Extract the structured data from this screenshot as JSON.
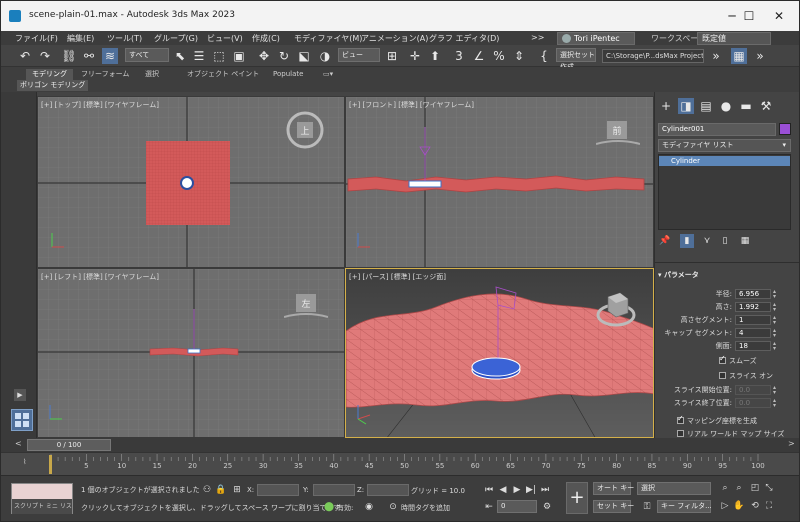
{
  "window": {
    "title": "scene-plain-01.max - Autodesk 3ds Max 2023",
    "minimize": "─",
    "maximize": "☐",
    "close": "✕"
  },
  "menu": {
    "items": [
      "ファイル(F)",
      "編集(E)",
      "ツール(T)",
      "グループ(G)",
      "ビュー(V)",
      "作成(C)",
      "モディファイヤ(M)",
      "アニメーション(A)",
      "グラフ エディタ(D)",
      ">>"
    ],
    "user": "Tori iPentec",
    "workspace_label": "ワークスペース:",
    "workspace_value": "既定値"
  },
  "toolbar": {
    "filter": "すべて",
    "view_dropdown": "ビュー",
    "selection_set": "選択セット作成",
    "project_path": "C:\\Storage\\P...dsMax Project"
  },
  "ribbon": {
    "tabs": [
      "モデリング",
      "フリーフォーム",
      "選択",
      "オブジェクト ペイント",
      "Populate"
    ],
    "sub": "ポリゴン モデリング"
  },
  "viewports": {
    "top": "[+] [トップ] [標準] [ワイヤフレーム]",
    "front": "[+] [フロント] [標準] [ワイヤフレーム]",
    "left": "[+] [レフト] [標準] [ワイヤフレーム]",
    "persp": "[+] [パース] [標準] [エッジ面]",
    "cube_top": "上",
    "cube_front": "前",
    "cube_left": "左"
  },
  "command_panel": {
    "object_name": "Cylinder001",
    "object_color": "#9a4fd6",
    "modifier_list": "モディファイヤ リスト",
    "stack_item": "Cylinder",
    "rollout_title": "パラメータ",
    "params": [
      {
        "label": "半径:",
        "value": "6.956"
      },
      {
        "label": "高さ:",
        "value": "1.992"
      },
      {
        "label": "高さセグメント:",
        "value": "1"
      },
      {
        "label": "キャップ セグメント:",
        "value": "4"
      },
      {
        "label": "側面:",
        "value": "18"
      }
    ],
    "smooth": "スムーズ",
    "slice_on": "スライス オン",
    "slice_from": {
      "label": "スライス開始位置:",
      "value": "0.0"
    },
    "slice_to": {
      "label": "スライス終了位置:",
      "value": "0.0"
    },
    "gen_mapping": "マッピング座標を生成",
    "realworld": "リアル ワールド マップ サイズ"
  },
  "timeline": {
    "frame_display": "0 / 100",
    "ticks": [
      "5",
      "10",
      "15",
      "20",
      "25",
      "30",
      "35",
      "40",
      "45",
      "50",
      "55",
      "60",
      "65",
      "70",
      "75",
      "80",
      "85",
      "90",
      "95",
      "100"
    ]
  },
  "status": {
    "maxscript": "スクリプト ミニ リスナー",
    "selected": "1 個のオブジェクトが選択されました",
    "hint": "クリックしてオブジェクトを選択し、ドラッグしてスペース ワープに割り当てます",
    "x_label": "X:",
    "y_label": "Y:",
    "z_label": "Z:",
    "grid": "グリッド = 10.0",
    "enabled": "有効:",
    "add_time_tag": "時間タグを追加",
    "auto_key": "オート キー",
    "set_key": "セット キー",
    "selection": "選択",
    "key_filter": "キー フィルタ...",
    "frame": "0"
  }
}
